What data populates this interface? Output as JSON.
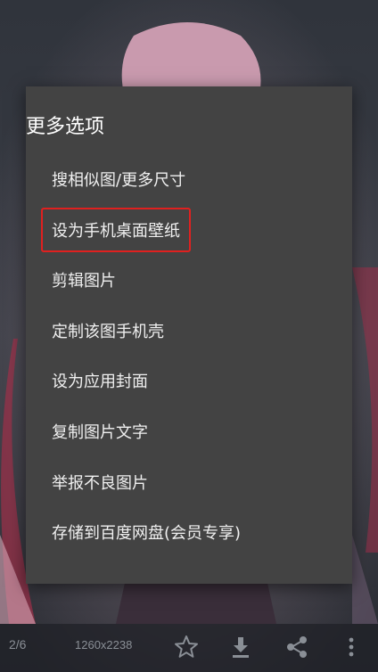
{
  "menu": {
    "title": "更多选项",
    "items": [
      {
        "label": "搜相似图/更多尺寸"
      },
      {
        "label": "设为手机桌面壁纸",
        "highlighted": true
      },
      {
        "label": "剪辑图片"
      },
      {
        "label": "定制该图手机壳"
      },
      {
        "label": "设为应用封面"
      },
      {
        "label": "复制图片文字"
      },
      {
        "label": "举报不良图片"
      },
      {
        "label": "存储到百度网盘(会员专享)"
      }
    ]
  },
  "viewer": {
    "page_index": "2/6",
    "resolution": "1260x2238",
    "actions": {
      "favorite_icon": "star-outline-icon",
      "download_icon": "download-icon",
      "share_icon": "share-icon",
      "more_icon": "more-vertical-icon"
    }
  },
  "colors": {
    "menu_background": "#434343",
    "highlight_border": "#e0201f",
    "icon_color": "#8a8f96"
  }
}
